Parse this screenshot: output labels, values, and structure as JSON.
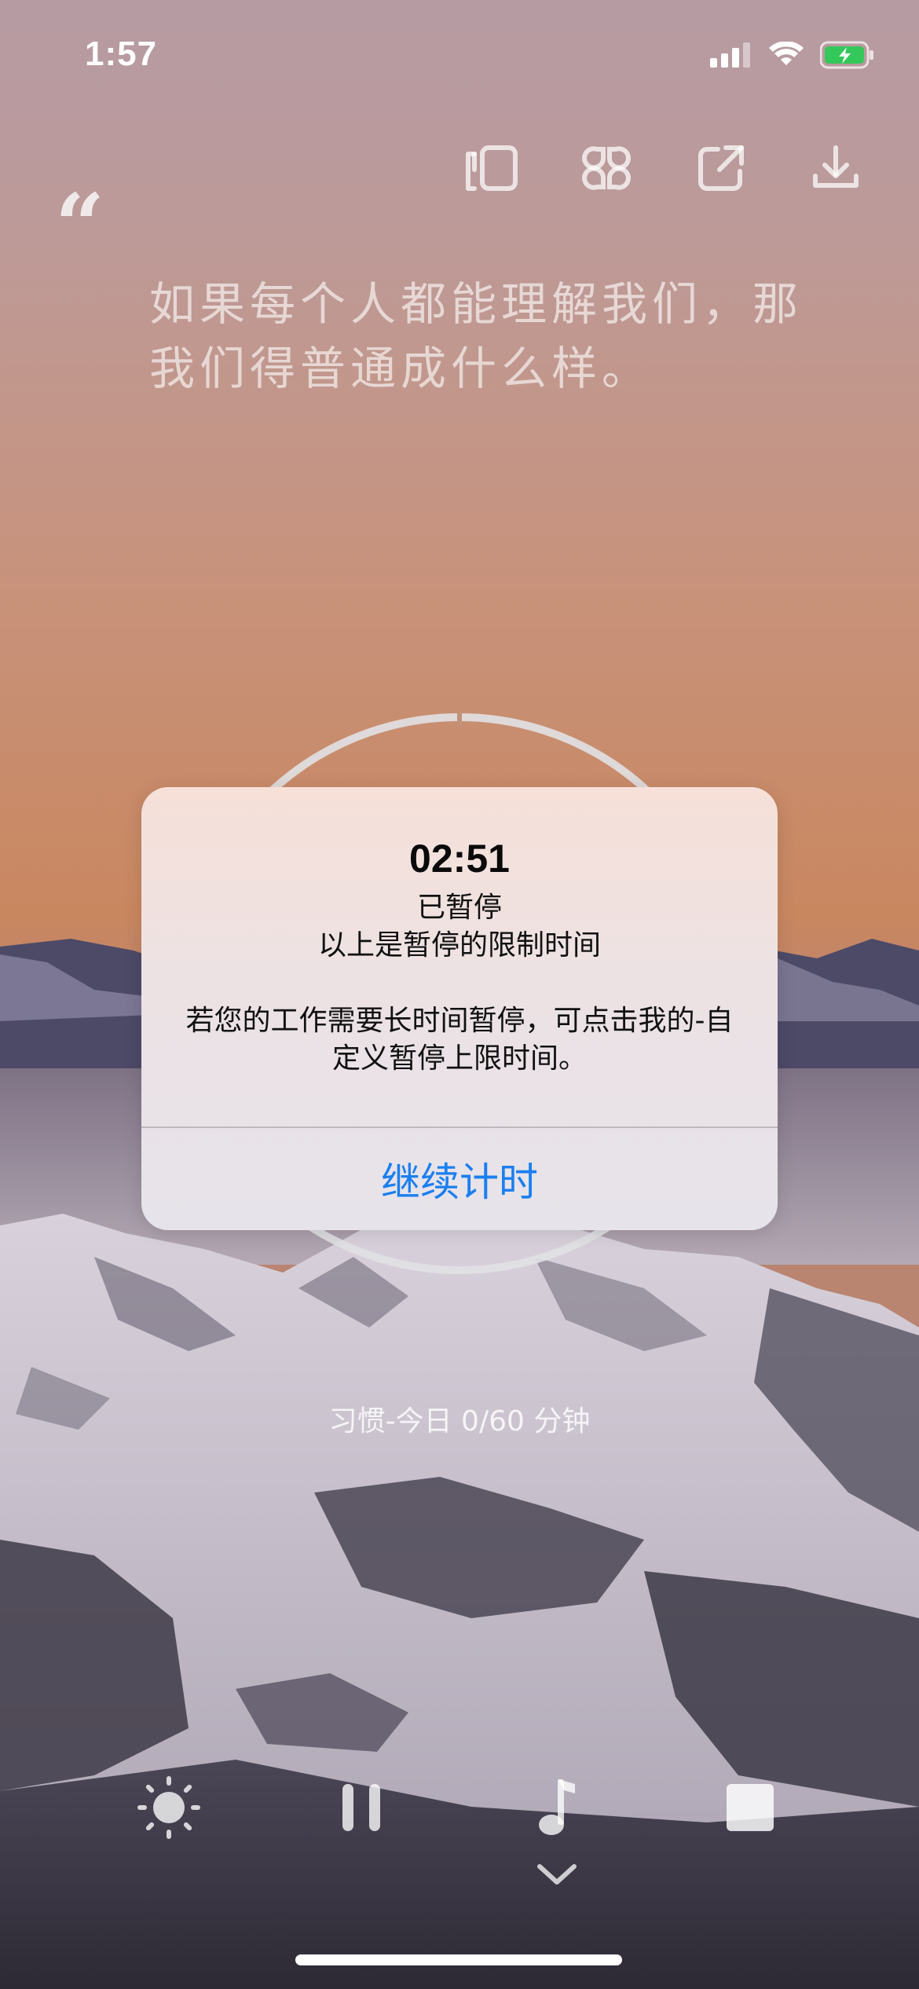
{
  "status_bar": {
    "time": "1:57"
  },
  "toolbar": {
    "icons": [
      "layout-icon",
      "grid-icon",
      "share-icon",
      "download-icon"
    ]
  },
  "quote": {
    "mark": "“",
    "text": "如果每个人都能理解我们，那我们得普通成什么样。"
  },
  "dialog": {
    "timer": "02:51",
    "line1": "已暂停",
    "line2": "以上是暂停的限制时间",
    "line3": "若您的工作需要长时间暂停，可点击我的-自定义暂停上限时间。",
    "action_label": "继续计时"
  },
  "habit_progress": "习惯-今日 0/60 分钟",
  "bottom_controls": [
    "brightness-icon",
    "pause-icon",
    "music-icon",
    "stop-icon"
  ],
  "colors": {
    "accent": "#1a7ff0",
    "sky_top": "#b59aa0",
    "sky_bottom": "#c98a64"
  }
}
